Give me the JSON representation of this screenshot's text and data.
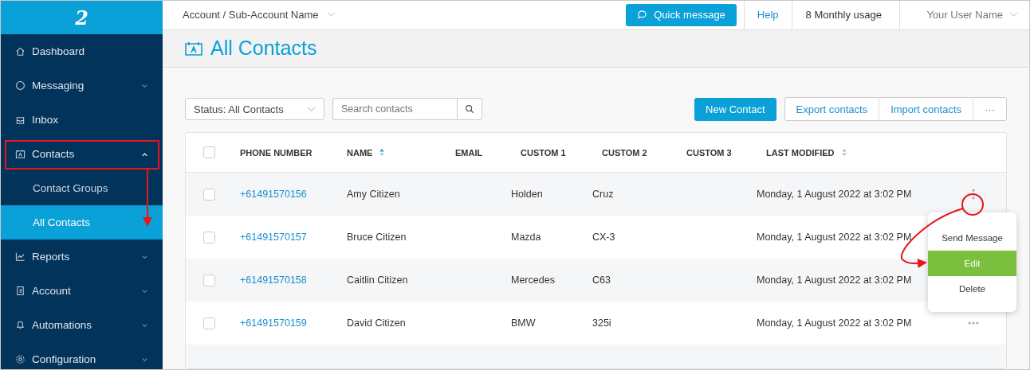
{
  "logo": {
    "text": "2"
  },
  "topbar": {
    "account": "Account / Sub-Account Name",
    "quick_message": "Quick message",
    "help": "Help",
    "usage": "8 Monthly usage",
    "user": "Your User Name"
  },
  "sidebar": {
    "items": [
      {
        "label": "Dashboard",
        "selected": false
      },
      {
        "label": "Messaging",
        "expanded": false,
        "selected": false
      },
      {
        "label": "Inbox",
        "selected": false
      },
      {
        "label": "Contacts",
        "expanded": true,
        "selected": false,
        "children": [
          {
            "label": "Contact Groups",
            "selected": false
          },
          {
            "label": "All Contacts",
            "selected": true
          }
        ]
      },
      {
        "label": "Reports",
        "expanded": false,
        "selected": false
      },
      {
        "label": "Account",
        "expanded": false,
        "selected": false
      },
      {
        "label": "Automations",
        "expanded": false,
        "selected": false
      },
      {
        "label": "Configuration",
        "expanded": false,
        "selected": false
      }
    ]
  },
  "page": {
    "title": "All Contacts"
  },
  "toolbar": {
    "status_filter": "Status: All Contacts",
    "search_placeholder": "Search contacts",
    "new_contact": "New Contact",
    "export": "Export contacts",
    "import": "Import contacts",
    "more": "···"
  },
  "table": {
    "all_checked": false,
    "columns": [
      {
        "label": "PHONE NUMBER"
      },
      {
        "label": "NAME",
        "sorted": true
      },
      {
        "label": "EMAIL"
      },
      {
        "label": "CUSTOM 1"
      },
      {
        "label": "CUSTOM 2"
      },
      {
        "label": "CUSTOM 3"
      },
      {
        "label": "LAST MODIFIED",
        "sorted": false
      }
    ],
    "rows": [
      {
        "checked": false,
        "phone": "+61491570156",
        "name": "Amy Citizen",
        "custom_1": "Holden",
        "custom_2": "Cruz",
        "modified": "Monday, 1 August 2022 at 3:02 PM",
        "menu_open": true
      },
      {
        "checked": false,
        "phone": "+61491570157",
        "name": "Bruce Citizen",
        "custom_1": "Mazda",
        "custom_2": "CX-3",
        "modified": "Monday, 1 August 2022 at 3:02 PM",
        "menu_open": false
      },
      {
        "checked": false,
        "phone": "+61491570158",
        "name": "Caitlin Citizen",
        "custom_1": "Mercedes",
        "custom_2": "C63",
        "modified": "Monday, 1 August 2022 at 3:02 PM",
        "menu_open": false
      },
      {
        "checked": false,
        "phone": "+61491570159",
        "name": "David Citizen",
        "custom_1": "BMW",
        "custom_2": "325i",
        "modified": "Monday, 1 August 2022 at 3:02 PM",
        "menu_open": false
      }
    ]
  },
  "row_menu": {
    "items": [
      {
        "label": "Send Message",
        "selected": false
      },
      {
        "label": "Edit",
        "selected": true
      },
      {
        "label": "Delete",
        "selected": false
      }
    ]
  }
}
